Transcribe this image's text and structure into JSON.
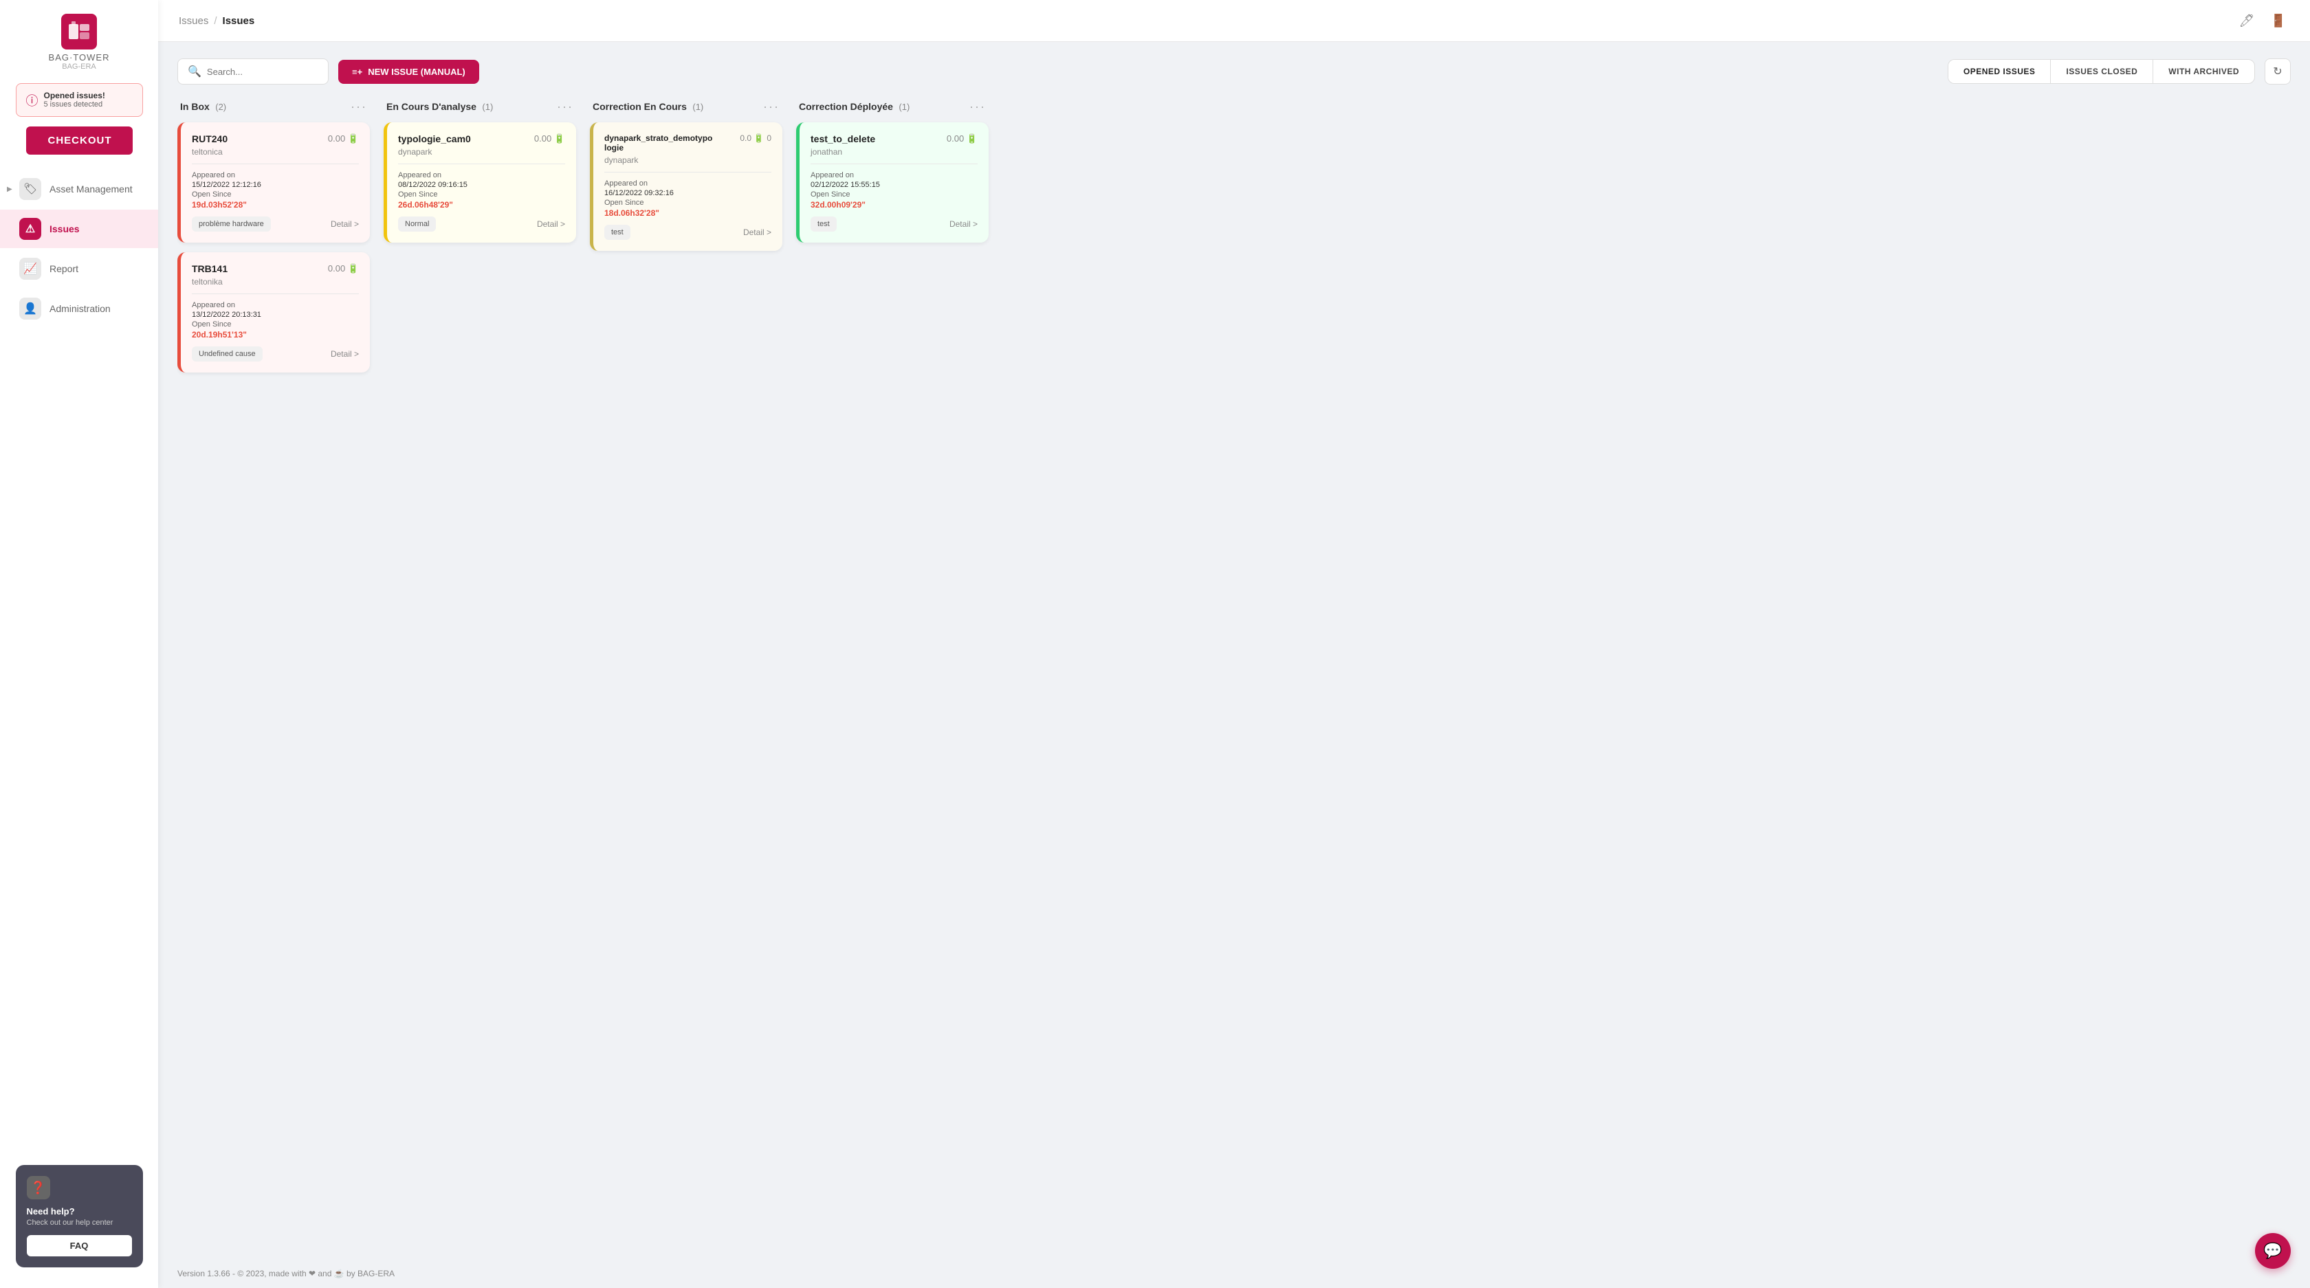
{
  "app": {
    "name": "BAG·TOWER",
    "subtitle": "BAG-ERA"
  },
  "sidebar": {
    "alert": {
      "title": "Opened issues!",
      "subtitle": "5 issues detected"
    },
    "checkout_label": "CHECKOUT",
    "nav": [
      {
        "id": "asset-management",
        "label": "Asset Management",
        "icon": "🏷"
      },
      {
        "id": "issues",
        "label": "Issues",
        "icon": "⚠",
        "active": true
      },
      {
        "id": "report",
        "label": "Report",
        "icon": "📈"
      },
      {
        "id": "administration",
        "label": "Administration",
        "icon": "👤"
      }
    ],
    "help": {
      "title": "Need help?",
      "subtitle": "Check out our help center",
      "faq_label": "FAQ"
    }
  },
  "topbar": {
    "breadcrumb_parent": "Issues",
    "breadcrumb_current": "Issues"
  },
  "toolbar": {
    "search_placeholder": "Search...",
    "new_issue_label": "NEW ISSUE (MANUAL)",
    "tabs": [
      {
        "id": "opened",
        "label": "OPENED ISSUES",
        "active": true
      },
      {
        "id": "closed",
        "label": "ISSUES CLOSED"
      },
      {
        "id": "archived",
        "label": "WITH ARCHIVED"
      }
    ]
  },
  "columns": [
    {
      "id": "inbox",
      "title": "In Box",
      "count": 2,
      "cards": [
        {
          "id": "rut240",
          "title": "RUT240",
          "score": "0.00",
          "subtitle": "teltonica",
          "appeared_on_label": "Appeared on",
          "appeared_on": "15/12/2022 12:12:16",
          "open_since_label": "Open Since",
          "open_since": "19d.03h52'28\"",
          "tag": "problème hardware",
          "detail": "Detail >",
          "color": "red"
        },
        {
          "id": "trb141",
          "title": "TRB141",
          "score": "0.00",
          "subtitle": "teltonika",
          "appeared_on_label": "Appeared on",
          "appeared_on": "13/12/2022 20:13:31",
          "open_since_label": "Open Since",
          "open_since": "20d.19h51'13\"",
          "tag": "Undefined cause",
          "detail": "Detail >",
          "color": "red"
        }
      ]
    },
    {
      "id": "en-cours",
      "title": "En Cours D'analyse",
      "count": 1,
      "cards": [
        {
          "id": "typologie-cam0",
          "title": "typologie_cam0",
          "score": "0.00",
          "subtitle": "dynapark",
          "appeared_on_label": "Appeared on",
          "appeared_on": "08/12/2022 09:16:15",
          "open_since_label": "Open Since",
          "open_since": "26d.06h48'29\"",
          "tag": "Normal",
          "detail": "Detail >",
          "color": "yellow"
        }
      ]
    },
    {
      "id": "correction-en-cours",
      "title": "Correction En Cours",
      "count": 1,
      "cards": [
        {
          "id": "dynapark-strato",
          "title": "dynapark_strato_demotypo",
          "title2": "logie",
          "score": "0.0",
          "score2": "0",
          "subtitle": "dynapark",
          "appeared_on_label": "Appeared on",
          "appeared_on": "16/12/2022 09:32:16",
          "open_since_label": "Open Since",
          "open_since": "18d.06h32'28\"",
          "tag": "test",
          "detail": "Detail >",
          "color": "olive"
        }
      ]
    },
    {
      "id": "correction-deployee",
      "title": "Correction Déployée",
      "count": 1,
      "cards": [
        {
          "id": "test-to-delete",
          "title": "test_to_delete",
          "score": "0.00",
          "subtitle": "jonathan",
          "appeared_on_label": "Appeared on",
          "appeared_on": "02/12/2022 15:55:15",
          "open_since_label": "Open Since",
          "open_since": "32d.00h09'29\"",
          "tag": "test",
          "detail": "Detail >",
          "color": "green"
        }
      ]
    }
  ],
  "footer": {
    "text": "Version 1.3.66 - © 2023, made with ❤ and ☕ by BAG-ERA"
  }
}
